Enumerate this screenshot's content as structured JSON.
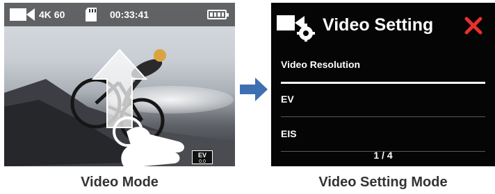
{
  "video_mode": {
    "status_bar": {
      "resolution": "4K 60",
      "timer": "00:33:41",
      "icons": [
        "video-camera-icon",
        "sd-card-icon",
        "battery-icon"
      ]
    },
    "ev_badge": {
      "label": "EV",
      "value": "0.0"
    },
    "gesture": "swipe-up"
  },
  "setting_mode": {
    "title": "Video Setting",
    "menu_items": [
      "Video Resolution",
      "EV",
      "EIS"
    ],
    "pager": "1 / 4",
    "colors": {
      "close": "#e8302c",
      "selected_line": "#ffffff"
    }
  },
  "arrow_color": "#3f6fb3",
  "captions": {
    "left": "Video Mode",
    "right": "Video Setting Mode"
  }
}
